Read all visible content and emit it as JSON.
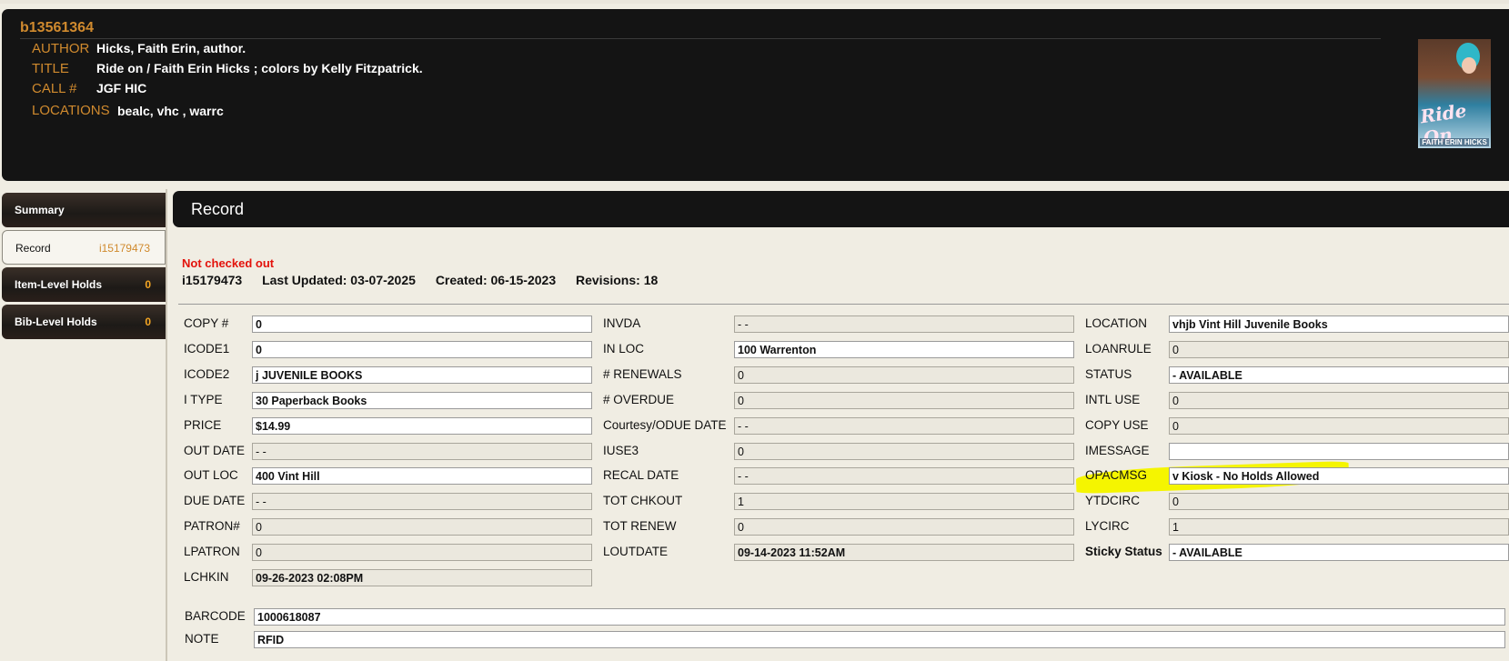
{
  "header": {
    "bib_id": "b13561364",
    "author_label": "AUTHOR",
    "author": "Hicks, Faith Erin, author.",
    "title_label": "TITLE",
    "title": "Ride on / Faith Erin Hicks ; colors by Kelly Fitzpatrick.",
    "call_label": "CALL #",
    "call": "JGF HIC",
    "locations_label": "LOCATIONS",
    "locations": "bealc, vhc  , warrc",
    "cover": {
      "title": "Ride On",
      "author": "FAITH ERIN HICKS"
    }
  },
  "sidebar": {
    "items": [
      {
        "label": "Summary",
        "count": ""
      },
      {
        "label": "Record",
        "count": "i15179473"
      },
      {
        "label": "Item-Level Holds",
        "count": "0"
      },
      {
        "label": "Bib-Level Holds",
        "count": "0"
      }
    ]
  },
  "record": {
    "title": "Record",
    "status": "Not checked out",
    "item_id": "i15179473",
    "last_updated": "Last Updated: 03-07-2025",
    "created": "Created: 06-15-2023",
    "revisions": "Revisions: 18"
  },
  "fields": {
    "col1": [
      {
        "label": "COPY #",
        "value": "0",
        "editable": true
      },
      {
        "label": "ICODE1",
        "value": "0",
        "editable": true
      },
      {
        "label": "ICODE2",
        "value": "j  JUVENILE BOOKS",
        "editable": true
      },
      {
        "label": "I TYPE",
        "value": "30  Paperback Books",
        "editable": true
      },
      {
        "label": "PRICE",
        "value": "$14.99",
        "editable": true
      },
      {
        "label": "OUT DATE",
        "value": "-  -",
        "editable": false
      },
      {
        "label": "OUT LOC",
        "value": "400  Vint Hill",
        "editable": true
      },
      {
        "label": "DUE DATE",
        "value": "-  -",
        "editable": false
      },
      {
        "label": "PATRON#",
        "value": "0",
        "editable": false
      },
      {
        "label": "LPATRON",
        "value": "0",
        "editable": false
      },
      {
        "label": "LCHKIN",
        "value": "09-26-2023 02:08PM",
        "editable": false
      }
    ],
    "col2": [
      {
        "label": "INVDA",
        "value": "-  -",
        "editable": false
      },
      {
        "label": "IN LOC",
        "value": "100  Warrenton",
        "editable": true
      },
      {
        "label": "# RENEWALS",
        "value": "0",
        "editable": false
      },
      {
        "label": "# OVERDUE",
        "value": "0",
        "editable": false
      },
      {
        "label": "Courtesy/ODUE DATE",
        "value": "-  -",
        "editable": false
      },
      {
        "label": "IUSE3",
        "value": "0",
        "editable": false
      },
      {
        "label": "RECAL DATE",
        "value": "-  -",
        "editable": false
      },
      {
        "label": "TOT CHKOUT",
        "value": "1",
        "editable": false
      },
      {
        "label": "TOT RENEW",
        "value": "0",
        "editable": false
      },
      {
        "label": "LOUTDATE",
        "value": "09-14-2023 11:52AM",
        "editable": false
      }
    ],
    "col3": [
      {
        "label": "LOCATION",
        "value": "vhjb   Vint Hill Juvenile Books",
        "editable": true
      },
      {
        "label": "LOANRULE",
        "value": "0",
        "editable": false
      },
      {
        "label": "STATUS",
        "value": "-    AVAILABLE",
        "editable": true
      },
      {
        "label": "INTL USE",
        "value": "0",
        "editable": false
      },
      {
        "label": "COPY USE",
        "value": "0",
        "editable": false
      },
      {
        "label": "IMESSAGE",
        "value": "",
        "editable": true
      },
      {
        "label": "OPACMSG",
        "value": "v  Kiosk - No Holds Allowed",
        "editable": true
      },
      {
        "label": "YTDCIRC",
        "value": "0",
        "editable": false
      },
      {
        "label": "LYCIRC",
        "value": "1",
        "editable": false
      },
      {
        "label": "Sticky Status",
        "value": "-    AVAILABLE",
        "editable": true
      }
    ],
    "barcode_label": "BARCODE",
    "barcode": "1000618087",
    "note_label": "NOTE",
    "note": "RFID"
  },
  "colors": {
    "accent": "#d08a2e",
    "header_bg": "#141414",
    "page_bg": "#f0ede3",
    "alert": "#e3120b",
    "highlight": "#f5f500"
  }
}
